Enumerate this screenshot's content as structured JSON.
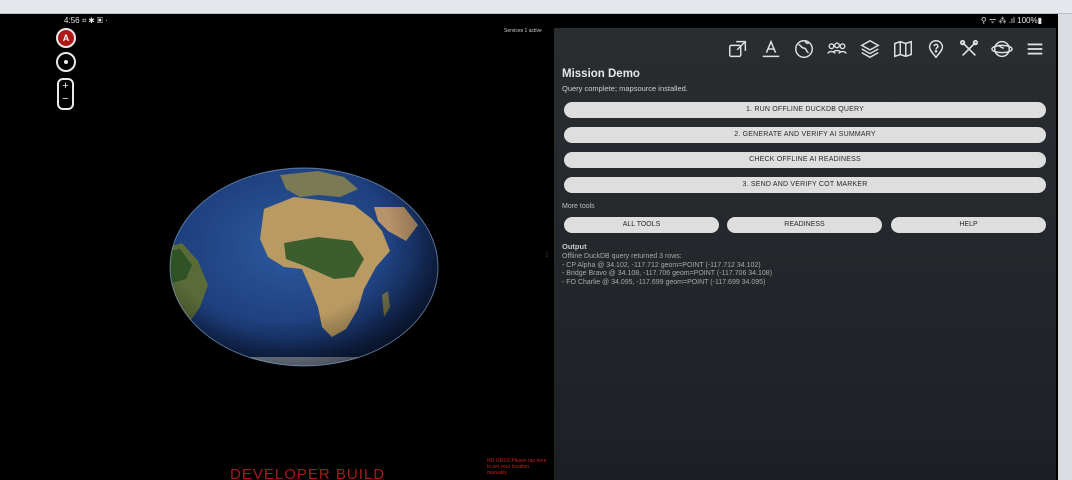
{
  "status_bar": {
    "time": "4:56",
    "left_icons": "⌗ ✱ ▣ ·",
    "right": "⚲ ᯤ ⁂ .ıl 100%▮"
  },
  "map": {
    "services_text": "Services 1 active",
    "compass_label": "A",
    "zoom_in": "+",
    "zoom_out": "−",
    "developer_build": "DEVELOPER BUILD",
    "no_gnss_text": "NO GNSS Please tap here to set your location manually",
    "colors": {
      "ocean": "#1d3d7a",
      "land": "#b89a62",
      "vegetation": "#3c5e2e",
      "compass_red": "#b01818",
      "dev_red": "#a81a1a"
    }
  },
  "toolbar": {
    "icons": [
      "external-link-icon",
      "text-tool-icon",
      "globe-icon",
      "group-icon",
      "layers-icon",
      "map-icon",
      "location-help-icon",
      "tools-cross-icon",
      "orbit-globe-icon",
      "menu-icon"
    ]
  },
  "panel": {
    "title": "Mission Demo",
    "status": "Query complete; mapsource installed.",
    "buttons": [
      "1. RUN OFFLINE DUCKDB QUERY",
      "2. GENERATE AND VERIFY AI SUMMARY",
      "CHECK OFFLINE AI READINESS",
      "3. SEND AND VERIFY COT MARKER"
    ],
    "more_tools_label": "More tools",
    "more_tools": [
      "ALL TOOLS",
      "READINESS",
      "HELP"
    ],
    "output_label": "Output",
    "output_lines": [
      "Offline DuckDB query returned 3 rows:",
      "- CP Alpha @ 34.102, -117.712 geom=POINT (-117.712 34.102)",
      "- Bridge Bravo @ 34.108, -117.706 geom=POINT (-117.706 34.108)",
      "- FO Charlie @ 34.095, -117.699 geom=POINT (-117.699 34.095)"
    ]
  }
}
